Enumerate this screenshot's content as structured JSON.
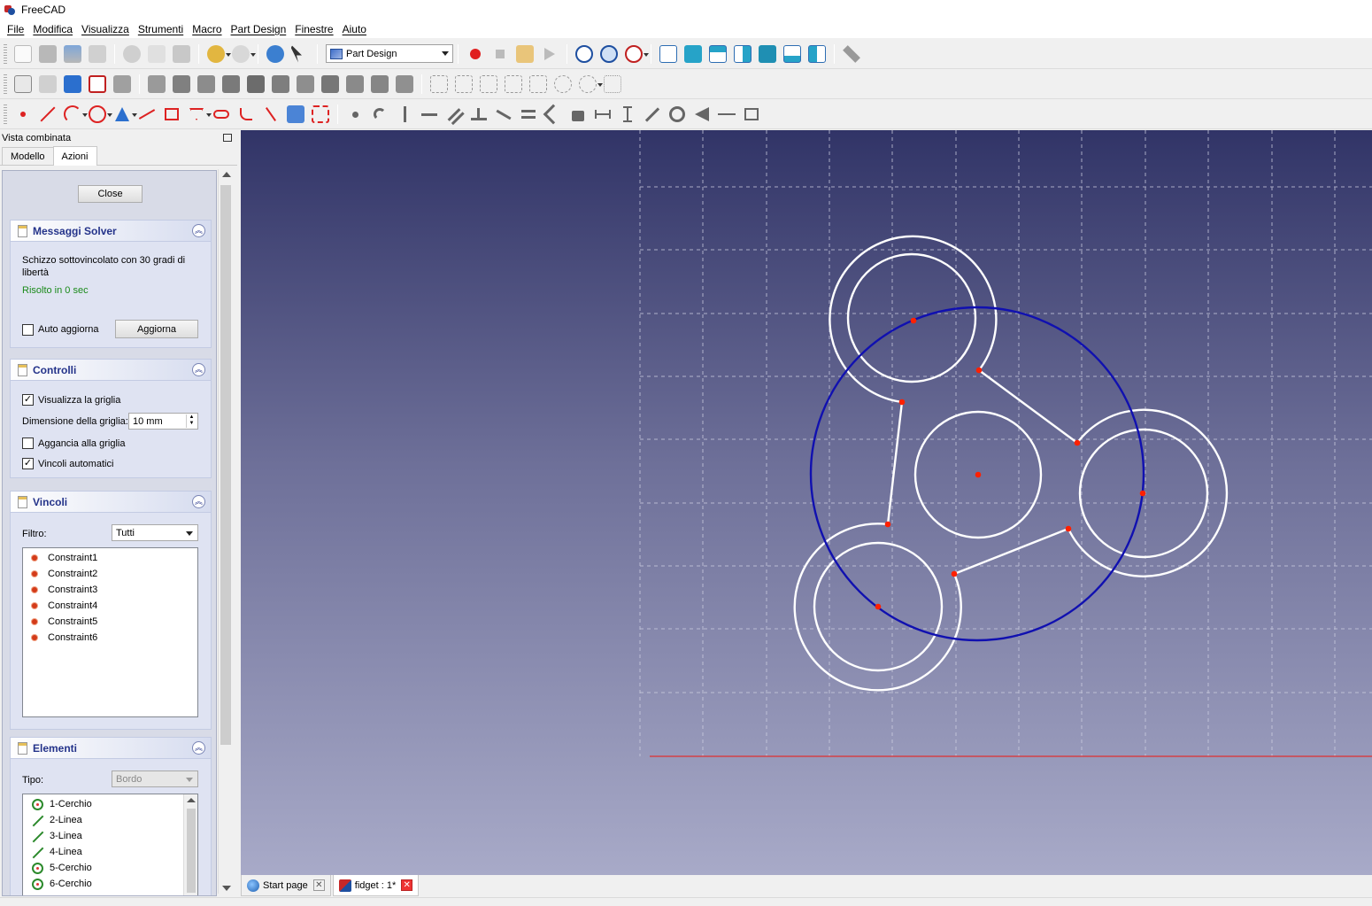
{
  "window": {
    "title": "FreeCAD"
  },
  "menu": [
    "File",
    "Modifica",
    "Visualizza",
    "Strumenti",
    "Macro",
    "Part Design",
    "Finestre",
    "Aiuto"
  ],
  "toolbar": {
    "workbench": "Part Design"
  },
  "panel": {
    "title": "Vista combinata",
    "tabs": [
      "Modello",
      "Azioni"
    ],
    "active_tab": "Azioni",
    "close_label": "Close",
    "solver": {
      "title": "Messaggi Solver",
      "message": "Schizzo sottovincolato con 30 gradi di libertà",
      "solved": "Risolto in 0 sec",
      "auto_update_label": "Auto aggiorna",
      "auto_update": false,
      "update_label": "Aggiorna"
    },
    "controls": {
      "title": "Controlli",
      "show_grid_label": "Visualizza la griglia",
      "show_grid": true,
      "grid_size_label": "Dimensione della griglia:",
      "grid_size_value": "10 mm",
      "snap_label": "Aggancia alla griglia",
      "snap": false,
      "auto_constraints_label": "Vincoli automatici",
      "auto_constraints": true
    },
    "constraints": {
      "title": "Vincoli",
      "filter_label": "Filtro:",
      "filter_value": "Tutti",
      "items": [
        "Constraint1",
        "Constraint2",
        "Constraint3",
        "Constraint4",
        "Constraint5",
        "Constraint6"
      ]
    },
    "elements": {
      "title": "Elementi",
      "type_label": "Tipo:",
      "type_value": "Bordo",
      "items": [
        {
          "label": "1-Cerchio",
          "kind": "circle"
        },
        {
          "label": "2-Linea",
          "kind": "line"
        },
        {
          "label": "3-Linea",
          "kind": "line"
        },
        {
          "label": "4-Linea",
          "kind": "line"
        },
        {
          "label": "5-Cerchio",
          "kind": "circle"
        },
        {
          "label": "6-Cerchio",
          "kind": "circle"
        }
      ]
    }
  },
  "doc_tabs": [
    {
      "label": "Start page",
      "active": false
    },
    {
      "label": "fidget : 1*",
      "active": true
    }
  ],
  "colors": {
    "construction": "#1010b0",
    "geometry": "#ffffff",
    "points": "#ff2000",
    "axis": "#e03030",
    "grid": "#c8c8dc"
  }
}
